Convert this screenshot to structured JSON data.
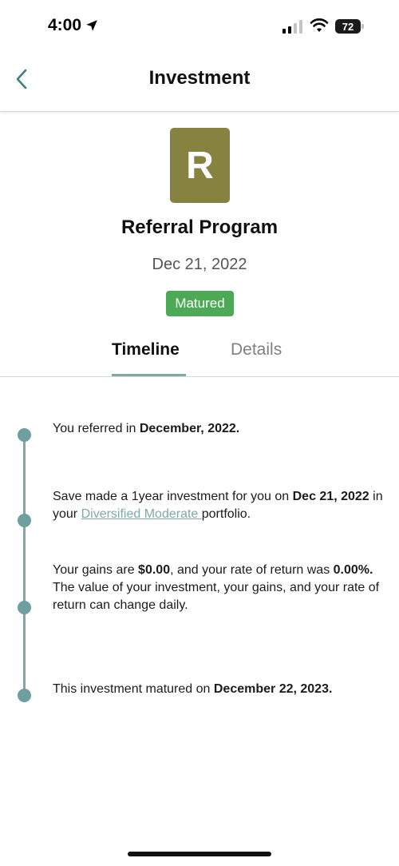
{
  "status_bar": {
    "time": "4:00",
    "battery": "72"
  },
  "nav": {
    "title": "Investment"
  },
  "header": {
    "logo_letter": "R",
    "program_name": "Referral Program",
    "date": "Dec 21, 2022",
    "status": "Matured",
    "status_color": "#4ea956",
    "logo_color": "#86823f"
  },
  "tabs": [
    {
      "label": "Timeline",
      "active": true
    },
    {
      "label": "Details",
      "active": false
    }
  ],
  "timeline": {
    "accent_color": "#7fa8a7",
    "entry1": {
      "t1": "You referred  in ",
      "b1": "December, 2022."
    },
    "entry2": {
      "t1": "Save made a 1year investment   for you on ",
      "b1": "Dec 21, 2022",
      "t2": " in your ",
      "link": "Diversified Moderate ",
      "t3": " portfolio."
    },
    "entry3": {
      "t1": "Your gains are ",
      "b1": "$0.00",
      "t2": ", and your rate of return was ",
      "b2": "0.00%.",
      "t3": " The value of your investment, your gains, and your rate of return can change daily."
    },
    "entry4": {
      "t1": "This investment matured on ",
      "b1": "December 22, 2023."
    }
  }
}
